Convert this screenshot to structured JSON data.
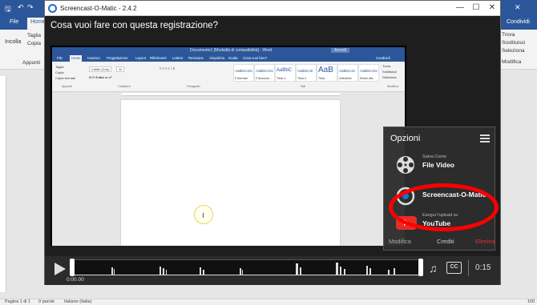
{
  "word_bg": {
    "tabs": [
      "File",
      "Home"
    ],
    "ribbon": {
      "taglia": "Taglia",
      "copia": "Copia",
      "incolla": "Incolla",
      "appunti": "Appunti",
      "right_items": [
        "Trova",
        "Sostituisci",
        "Seleziona",
        "Modifica"
      ],
      "user": "Condividi"
    },
    "status": {
      "page": "Pagina 1 di 1",
      "words": "0 parole",
      "lang": "Italiano (Italia)",
      "zoom": "100"
    }
  },
  "som": {
    "title": "Screencast-O-Matic - 2.4.2",
    "prompt": "Cosa vuoi fare con questa registrazione?",
    "window_controls": {
      "minimize": "—",
      "maximize": "☐",
      "close": "✕"
    }
  },
  "embedded": {
    "title": "Documento1 [Modalità di compatibilità] - Word",
    "tabs": [
      "File",
      "Home",
      "Inserisci",
      "Progettazione",
      "Layout",
      "Riferimenti",
      "Lettere",
      "Revisione",
      "Visualizza",
      "Guida",
      "Cosa vuoi fare?"
    ],
    "account": "Accedi",
    "share": "Condividi",
    "styles": [
      {
        "preview": "AaBbCcDc",
        "label": "¶ Normale"
      },
      {
        "preview": "AaBbCcDc",
        "label": "¶ Nessuna..."
      },
      {
        "preview": "AaBbC",
        "label": "Titolo 1"
      },
      {
        "preview": "AaBbCcE",
        "label": "Titolo 2"
      },
      {
        "preview": "AaB",
        "label": "Titolo"
      },
      {
        "preview": "AaBbCcD",
        "label": "Sottotitolo"
      },
      {
        "preview": "AaBbCcDc",
        "label": "Enfasi deli..."
      }
    ],
    "groups": [
      "Appunti",
      "Carattere",
      "Paragrafo",
      "Stili",
      "Modifica"
    ],
    "ribbon_left": [
      "Taglia",
      "Copia",
      "Copia formato"
    ],
    "font": "Calibri (Corp",
    "font_size": "11",
    "ribbon_right": [
      "Trova",
      "Sostituisci",
      "Seleziona"
    ]
  },
  "options": {
    "header": "Opzioni",
    "items": [
      {
        "small": "Salva Come",
        "big": "File Video",
        "icon": "film-reel-icon"
      },
      {
        "small": "",
        "big": "Screencast-O-Matic",
        "icon": "screencast-logo-icon"
      },
      {
        "small": "Esegui l'upload su",
        "big": "YouTube",
        "icon": "youtube-icon"
      }
    ],
    "footer": {
      "left": "Modifica",
      "mid": "Crediti",
      "right": "Elimina"
    }
  },
  "player": {
    "current_time": "0:00.00",
    "duration": "0:15",
    "cc": "CC"
  },
  "colors": {
    "word_blue": "#2b579a",
    "highlight_red": "#ff0000",
    "youtube_red": "#e52d27"
  }
}
